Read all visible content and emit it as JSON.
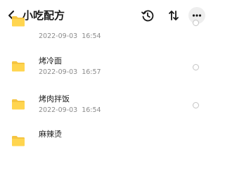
{
  "header": {
    "title": "小吃配方",
    "back_icon": "chevron-left-icon",
    "actions": [
      {
        "name": "history",
        "icon": "history-icon"
      },
      {
        "name": "sort",
        "icon": "sort-icon"
      },
      {
        "name": "more",
        "icon": "more-horizontal-icon"
      }
    ]
  },
  "files": [
    {
      "name": "",
      "date": "2022-09-03",
      "time": "16:54"
    },
    {
      "name": "烤冷面",
      "date": "2022-09-03",
      "time": "16:57"
    },
    {
      "name": "烤肉拌饭",
      "date": "2022-09-03",
      "time": "16:54"
    },
    {
      "name": "麻辣烫",
      "date": "",
      "time": ""
    }
  ],
  "colors": {
    "folder": "#FFD54F",
    "folder_back": "#F5C542",
    "title": "#1a1a1a",
    "meta": "#8c8c8c",
    "radio_border": "#c4c4c4"
  }
}
